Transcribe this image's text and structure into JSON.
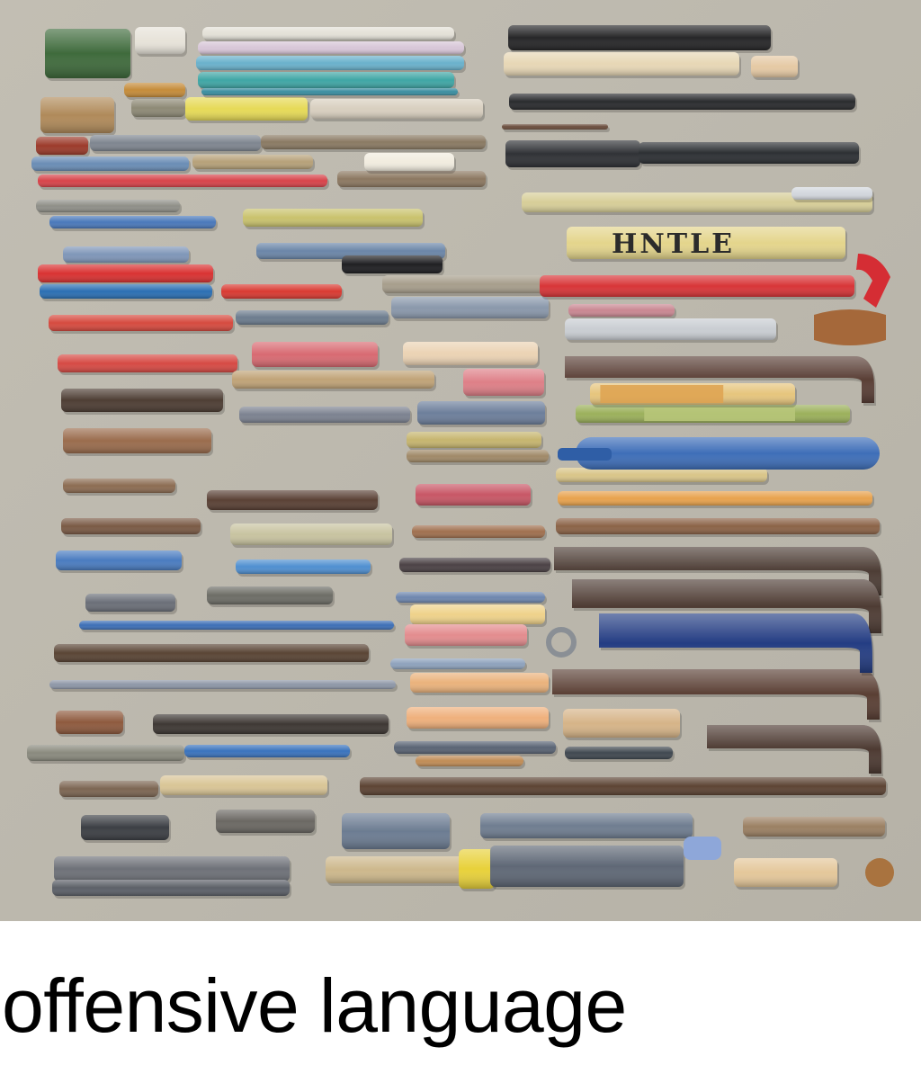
{
  "image": {
    "subject": "flat-lay photo of assorted pens, pencils, markers, sticks and tool handles arranged in rows on a grey surface",
    "background_color": "#bdb9ae",
    "printed_labels": [
      "HNTLE"
    ]
  },
  "caption": {
    "text": "offensive language"
  }
}
